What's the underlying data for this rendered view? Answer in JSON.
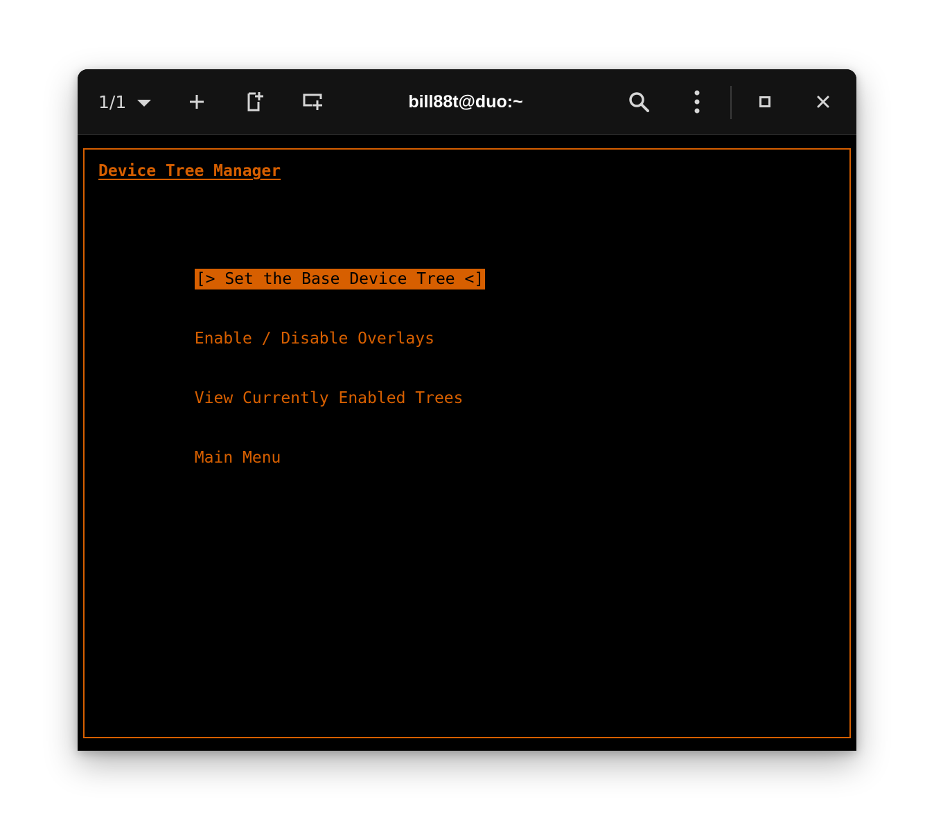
{
  "window": {
    "tab_counter": "1/1",
    "title": "bill88t@duo:~"
  },
  "toolbar": {
    "icons": [
      "chevron-down-icon",
      "plus-icon",
      "split-horizontal-icon",
      "new-window-icon",
      "search-icon",
      "more-vert-icon",
      "maximize-icon",
      "close-icon"
    ]
  },
  "terminal": {
    "heading": "Device Tree Manager",
    "menu": [
      {
        "label": "[> Set the Base Device Tree <]",
        "selected": true
      },
      {
        "label": "Enable / Disable Overlays",
        "selected": false
      },
      {
        "label": "View Currently Enabled Trees",
        "selected": false
      },
      {
        "label": "Main Menu",
        "selected": false
      }
    ]
  },
  "colors": {
    "accent": "#d75f00",
    "terminal_bg": "#000000",
    "titlebar_bg": "#131313",
    "title_text": "#ffffff"
  }
}
